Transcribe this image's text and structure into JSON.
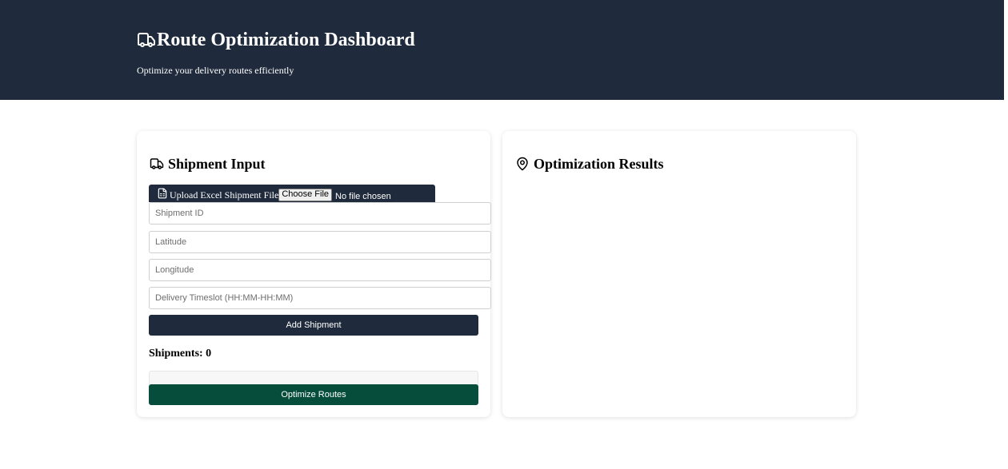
{
  "header": {
    "title": "Route Optimization Dashboard",
    "subtitle": "Optimize your delivery routes efficiently",
    "icon": "truck-icon",
    "background_color": "#1f2a3c"
  },
  "input_panel": {
    "title": "Shipment Input",
    "icon": "truck-icon",
    "upload": {
      "label": "Upload Excel Shipment File",
      "icon": "document-icon",
      "button_label": "Choose File",
      "status": "No file chosen"
    },
    "fields": {
      "shipment_id": {
        "placeholder": "Shipment ID",
        "value": ""
      },
      "latitude": {
        "placeholder": "Latitude",
        "value": ""
      },
      "longitude": {
        "placeholder": "Longitude",
        "value": ""
      },
      "timeslot": {
        "placeholder": "Delivery Timeslot (HH:MM-HH:MM)",
        "value": ""
      }
    },
    "add_button_label": "Add Shipment",
    "shipments_count_label": "Shipments: 0",
    "optimize_button_label": "Optimize Routes",
    "add_button_color": "#1f2a3c",
    "optimize_button_color": "#064e3b"
  },
  "results_panel": {
    "title": "Optimization Results",
    "icon": "map-pin-icon"
  }
}
